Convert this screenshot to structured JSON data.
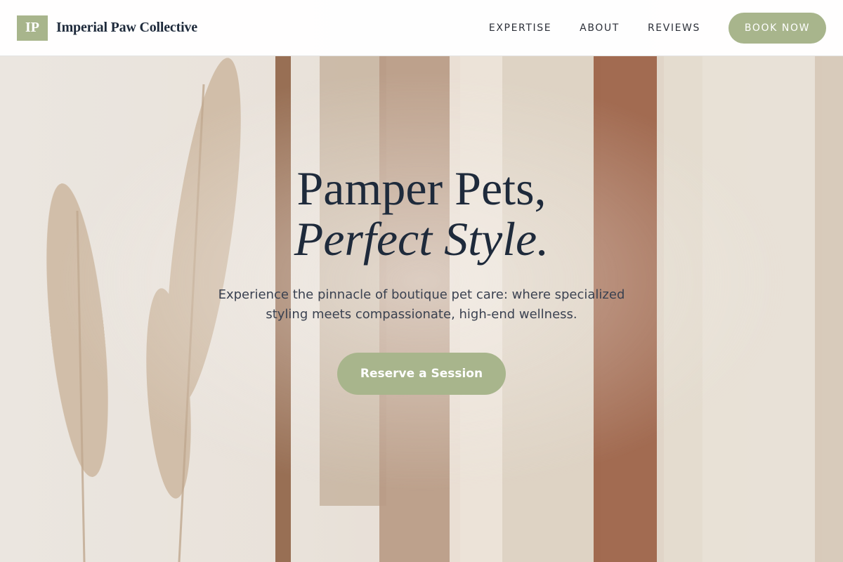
{
  "brand": {
    "logo_text": "IP",
    "name": "Imperial Paw Collective"
  },
  "nav": {
    "items": [
      {
        "label": "EXPERTISE"
      },
      {
        "label": "ABOUT"
      },
      {
        "label": "REVIEWS"
      }
    ],
    "cta_label": "BOOK NOW"
  },
  "hero": {
    "title_line1": "Pamper Pets,",
    "title_line2": "Perfect Style.",
    "subtitle": "Experience the pinnacle of boutique pet care: where specialized styling meets compassionate, high-end wellness.",
    "cta_label": "Reserve a Session"
  },
  "colors": {
    "accent": "#a8b58c",
    "heading": "#1e2a3b",
    "header_bg": "#ffffff"
  }
}
